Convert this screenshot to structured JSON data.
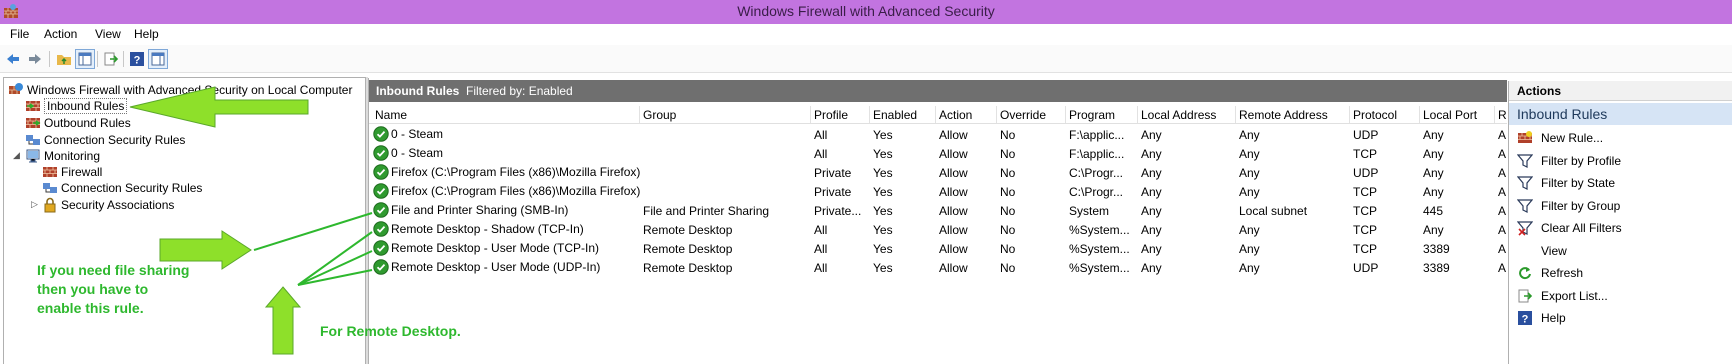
{
  "window": {
    "title": "Windows Firewall with Advanced Security"
  },
  "menu": [
    "File",
    "Action",
    "View",
    "Help"
  ],
  "toolbar": {
    "icons": [
      "back-arrow-icon",
      "forward-arrow-icon",
      "up-folder-icon",
      "show-hide-console-tree-icon",
      "export-list-icon",
      "help-icon",
      "show-hide-action-pane-icon"
    ]
  },
  "tree": {
    "root": "Windows Firewall with Advanced Security on Local Computer",
    "inbound": "Inbound Rules",
    "outbound": "Outbound Rules",
    "connection_security": "Connection Security Rules",
    "monitoring": "Monitoring",
    "mon_firewall": "Firewall",
    "mon_connection_security": "Connection Security Rules",
    "mon_security_associations": "Security Associations"
  },
  "center": {
    "header_title": "Inbound Rules",
    "filter_text": "Filtered by: Enabled",
    "columns": [
      "Name",
      "Group",
      "Profile",
      "Enabled",
      "Action",
      "Override",
      "Program",
      "Local Address",
      "Remote Address",
      "Protocol",
      "Local Port",
      "R"
    ],
    "rows": [
      [
        "0 - Steam",
        "",
        "All",
        "Yes",
        "Allow",
        "No",
        "F:\\applic...",
        "Any",
        "Any",
        "UDP",
        "Any",
        "A"
      ],
      [
        "0 - Steam",
        "",
        "All",
        "Yes",
        "Allow",
        "No",
        "F:\\applic...",
        "Any",
        "Any",
        "TCP",
        "Any",
        "A"
      ],
      [
        "Firefox (C:\\Program Files (x86)\\Mozilla Firefox)",
        "",
        "Private",
        "Yes",
        "Allow",
        "No",
        "C:\\Progr...",
        "Any",
        "Any",
        "UDP",
        "Any",
        "A"
      ],
      [
        "Firefox (C:\\Program Files (x86)\\Mozilla Firefox)",
        "",
        "Private",
        "Yes",
        "Allow",
        "No",
        "C:\\Progr...",
        "Any",
        "Any",
        "TCP",
        "Any",
        "A"
      ],
      [
        "File and Printer Sharing (SMB-In)",
        "File and Printer Sharing",
        "Private...",
        "Yes",
        "Allow",
        "No",
        "System",
        "Any",
        "Local subnet",
        "TCP",
        "445",
        "A"
      ],
      [
        "Remote Desktop - Shadow (TCP-In)",
        "Remote Desktop",
        "All",
        "Yes",
        "Allow",
        "No",
        "%System...",
        "Any",
        "Any",
        "TCP",
        "Any",
        "A"
      ],
      [
        "Remote Desktop - User Mode (TCP-In)",
        "Remote Desktop",
        "All",
        "Yes",
        "Allow",
        "No",
        "%System...",
        "Any",
        "Any",
        "TCP",
        "3389",
        "A"
      ],
      [
        "Remote Desktop - User Mode (UDP-In)",
        "Remote Desktop",
        "All",
        "Yes",
        "Allow",
        "No",
        "%System...",
        "Any",
        "Any",
        "UDP",
        "3389",
        "A"
      ]
    ]
  },
  "actions": {
    "title": "Actions",
    "section": "Inbound Rules",
    "items": [
      {
        "label": "New Rule...",
        "icon": "new-rule-icon"
      },
      {
        "label": "Filter by Profile",
        "icon": "filter-icon"
      },
      {
        "label": "Filter by State",
        "icon": "filter-icon"
      },
      {
        "label": "Filter by Group",
        "icon": "filter-icon"
      },
      {
        "label": "Clear All Filters",
        "icon": "clear-filter-icon"
      },
      {
        "label": "View",
        "icon": ""
      },
      {
        "label": "Refresh",
        "icon": "refresh-icon"
      },
      {
        "label": "Export List...",
        "icon": "export-list-icon"
      },
      {
        "label": "Help",
        "icon": "help-icon"
      }
    ]
  },
  "annotations": {
    "file_sharing_line1": "If you need file sharing",
    "file_sharing_line2": "then you have to",
    "file_sharing_line3": "enable this rule.",
    "remote_desktop": "For Remote Desktop."
  },
  "colors": {
    "titlebar": "#c274e0",
    "annotation": "#2eb82e",
    "annotation_arrow": "#8ee02a",
    "center_header": "#6f6f6f",
    "actions_section": "#d6e4f5"
  }
}
